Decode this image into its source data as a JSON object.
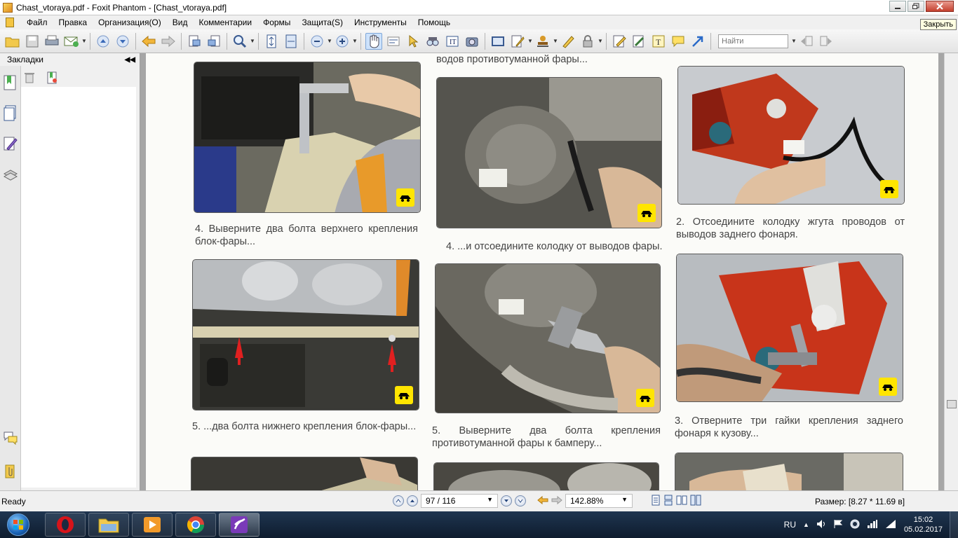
{
  "window": {
    "title": "Chast_vtoraya.pdf - Foxit Phantom - [Chast_vtoraya.pdf]",
    "tooltip": "Закрыть"
  },
  "menu": [
    "Файл",
    "Правка",
    "Организация(O)",
    "Вид",
    "Комментарии",
    "Формы",
    "Защита(S)",
    "Инструменты",
    "Помощь"
  ],
  "toolbar": {
    "search_placeholder": "Найти",
    "icons": [
      "open-icon",
      "save-icon",
      "print-icon",
      "email-icon",
      "prev-page-icon",
      "next-page-icon",
      "back-icon",
      "forward-icon",
      "extract-icon",
      "insert-icon",
      "zoom-icon",
      "fit-page-icon",
      "fit-width-icon",
      "zoom-out-icon",
      "zoom-in-icon",
      "hand-icon",
      "select-text-icon",
      "select-icon",
      "find-icon",
      "typewriter-icon",
      "snapshot-icon",
      "rectangle-icon",
      "edit-icon",
      "stamp-icon",
      "sign-icon",
      "lock-icon",
      "comment-icon",
      "text-icon",
      "note-icon",
      "arrow-icon"
    ]
  },
  "sidebar": {
    "title": "Закладки"
  },
  "document": {
    "captions": {
      "top_fragment": "водов противотуманной фары...",
      "c1": "4. Выверните два болта верхнего крепления блок-фары...",
      "c2": "4. ...и отсоедините колодку от выводов фары.",
      "c3": "2. Отсоедините колодку жгута проводов от выводов заднего фонаря.",
      "c4": "5. ...два болта нижнего крепления блок-фары...",
      "c5": "5. Выверните два болта крепления противотуманной фары к бамперу...",
      "c6": "3. Отверните три гайки крепления заднего фонаря к кузову..."
    }
  },
  "status": {
    "ready": "Ready",
    "page": "97 / 116",
    "zoom": "142.88%",
    "size": "Размер: [8.27 * 11.69 в]"
  },
  "taskbar": {
    "lang": "RU",
    "time": "15:02",
    "date": "05.02.2017"
  }
}
